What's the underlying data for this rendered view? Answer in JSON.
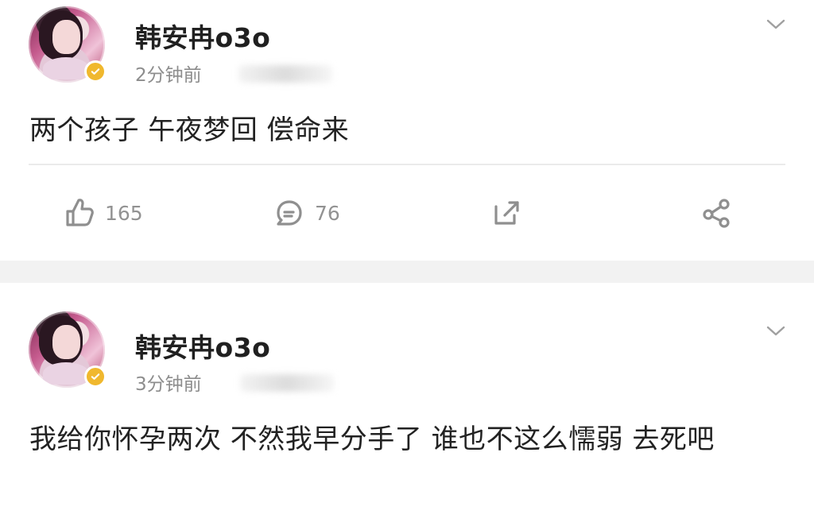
{
  "posts": [
    {
      "username": "韩安冉o3o",
      "time": "2分钟前",
      "content": "两个孩子 午夜梦回 偿命来",
      "actions": {
        "like_count": "165",
        "comment_count": "76"
      }
    },
    {
      "username": "韩安冉o3o",
      "time": "3分钟前",
      "content": "我给你怀孕两次 不然我早分手了 谁也不这么懦弱 去死吧"
    }
  ],
  "colors": {
    "background": "#f2f2f2",
    "card": "#ffffff",
    "text": "#222222",
    "secondary_text": "#8d8d8d",
    "verify_badge": "#f0b82e"
  },
  "icons": {
    "more": "chevron-down-icon",
    "like": "thumbs-up-icon",
    "comment": "comment-icon",
    "repost": "repost-icon",
    "share": "share-icon",
    "verified": "verified-badge-icon"
  }
}
